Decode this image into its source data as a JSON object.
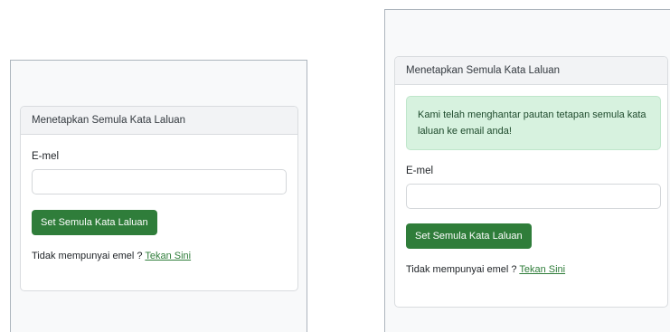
{
  "left_panel": {
    "card_title": "Menetapkan Semula Kata Laluan",
    "email_label": "E-mel",
    "email_value": "",
    "submit_label": "Set Semula Kata Laluan",
    "footer_text": "Tidak mempunyai emel ? ",
    "footer_link": "Tekan Sini"
  },
  "right_panel": {
    "card_title": "Menetapkan Semula Kata Laluan",
    "alert_message": "Kami telah menghantar pautan tetapan semula kata laluan ke email anda!",
    "email_label": "E-mel",
    "email_value": "",
    "submit_label": "Set Semula Kata Laluan",
    "footer_text": "Tidak mempunyai emel ? ",
    "footer_link": "Tekan Sini"
  },
  "colors": {
    "button": "#2f7d3a",
    "link": "#2f7d3a",
    "alert_background": "#d7f2df",
    "alert_text": "#1e4a2c"
  }
}
